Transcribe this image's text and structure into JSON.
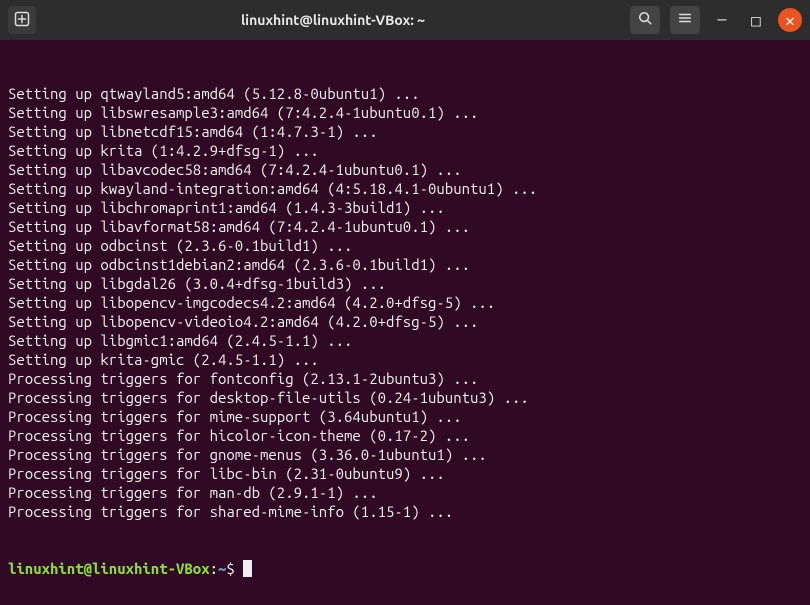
{
  "titlebar": {
    "new_tab_icon": "⊕",
    "title": "linuxhint@linuxhint-VBox: ~",
    "search_icon": "⌕",
    "menu_icon": "≡",
    "minimize_icon": "—",
    "maximize_icon": "□",
    "close_icon": "✕"
  },
  "terminal": {
    "lines": [
      "Setting up qtwayland5:amd64 (5.12.8-0ubuntu1) ...",
      "Setting up libswresample3:amd64 (7:4.2.4-1ubuntu0.1) ...",
      "Setting up libnetcdf15:amd64 (1:4.7.3-1) ...",
      "Setting up krita (1:4.2.9+dfsg-1) ...",
      "Setting up libavcodec58:amd64 (7:4.2.4-1ubuntu0.1) ...",
      "Setting up kwayland-integration:amd64 (4:5.18.4.1-0ubuntu1) ...",
      "Setting up libchromaprint1:amd64 (1.4.3-3build1) ...",
      "Setting up libavformat58:amd64 (7:4.2.4-1ubuntu0.1) ...",
      "Setting up odbcinst (2.3.6-0.1build1) ...",
      "Setting up odbcinst1debian2:amd64 (2.3.6-0.1build1) ...",
      "Setting up libgdal26 (3.0.4+dfsg-1build3) ...",
      "Setting up libopencv-imgcodecs4.2:amd64 (4.2.0+dfsg-5) ...",
      "Setting up libopencv-videoio4.2:amd64 (4.2.0+dfsg-5) ...",
      "Setting up libgmic1:amd64 (2.4.5-1.1) ...",
      "Setting up krita-gmic (2.4.5-1.1) ...",
      "Processing triggers for fontconfig (2.13.1-2ubuntu3) ...",
      "Processing triggers for desktop-file-utils (0.24-1ubuntu3) ...",
      "Processing triggers for mime-support (3.64ubuntu1) ...",
      "Processing triggers for hicolor-icon-theme (0.17-2) ...",
      "Processing triggers for gnome-menus (3.36.0-1ubuntu1) ...",
      "Processing triggers for libc-bin (2.31-0ubuntu9) ...",
      "Processing triggers for man-db (2.9.1-1) ...",
      "Processing triggers for shared-mime-info (1.15-1) ..."
    ],
    "prompt": {
      "user": "linuxhint@linuxhint-VBox",
      "colon": ":",
      "path": "~",
      "dollar": "$ "
    }
  }
}
